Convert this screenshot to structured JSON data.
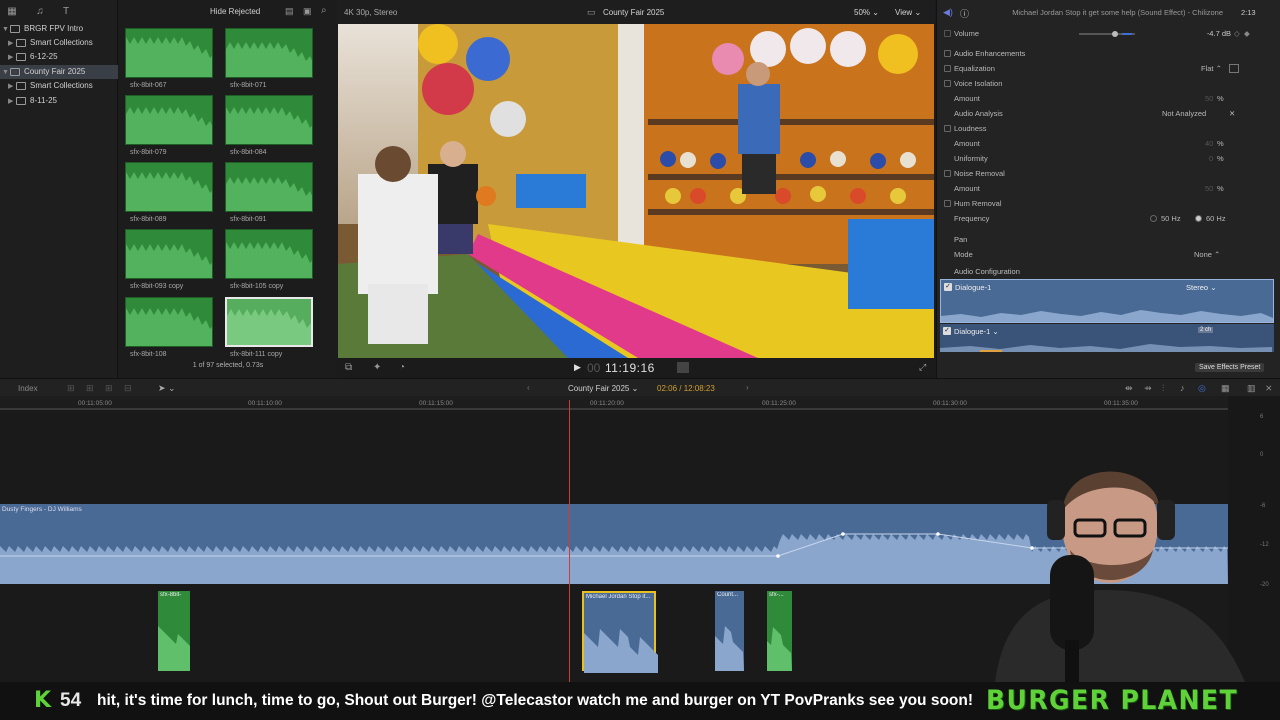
{
  "library": {
    "items": [
      {
        "label": "BRGR FPV Intro",
        "expanded": true,
        "selected": false
      },
      {
        "label": "Smart Collections",
        "expanded": false,
        "selected": false
      },
      {
        "label": "6-12-25",
        "expanded": false,
        "selected": false
      },
      {
        "label": "County Fair 2025",
        "expanded": true,
        "selected": true
      },
      {
        "label": "Smart Collections",
        "expanded": false,
        "selected": false
      },
      {
        "label": "8-11-25",
        "expanded": false,
        "selected": false
      }
    ]
  },
  "browser": {
    "filter_label": "Hide Rejected",
    "clips": [
      {
        "name": "sfx-8bit-067",
        "selected": false
      },
      {
        "name": "sfx-8bit-071",
        "selected": false
      },
      {
        "name": "sfx-8bit-079",
        "selected": false
      },
      {
        "name": "sfx-8bit-084",
        "selected": false
      },
      {
        "name": "sfx-8bit-089",
        "selected": false
      },
      {
        "name": "sfx-8bit-091",
        "selected": false
      },
      {
        "name": "sfx-8bit-093 copy",
        "selected": false
      },
      {
        "name": "sfx-8bit-105 copy",
        "selected": false
      },
      {
        "name": "sfx-8bit-108",
        "selected": false
      },
      {
        "name": "sfx-8bit-111 copy",
        "selected": true
      }
    ],
    "status": "1 of 97 selected, 0.73s"
  },
  "viewer": {
    "format": "4K 30p, Stereo",
    "project": "County Fair 2025",
    "zoom": "50%",
    "view_label": "View",
    "timecode_dim": "00",
    "timecode": "11:19:16"
  },
  "inspector": {
    "clip_title": "Michael Jordan Stop it get some help (Sound Effect) - Chilizone",
    "duration": "2:13",
    "volume_label": "Volume",
    "volume_value": "-4.7 dB",
    "audio_enhancements": "Audio Enhancements",
    "equalization": "Equalization",
    "equalization_value": "Flat",
    "voice_isolation": "Voice Isolation",
    "amount_label": "Amount",
    "vi_amount": "50",
    "audio_analysis": "Audio Analysis",
    "audio_analysis_value": "Not Analyzed",
    "loudness": "Loudness",
    "loudness_amount": "40",
    "uniformity": "Uniformity",
    "uniformity_value": "0",
    "noise_removal": "Noise Removal",
    "nr_amount": "50",
    "hum_removal": "Hum Removal",
    "frequency": "Frequency",
    "freq_50": "50 Hz",
    "freq_60": "60 Hz",
    "percent": "%",
    "pan": "Pan",
    "mode": "Mode",
    "mode_value": "None",
    "audio_config": "Audio Configuration",
    "channel1": "Dialogue-1",
    "channel1_format": "Stereo",
    "channel2": "Dialogue-1",
    "channel2_badge": "2 ch",
    "save_preset": "Save Effects Preset"
  },
  "timeline": {
    "index_label": "Index",
    "project_name": "County Fair 2025",
    "position": "02:06 / 12:08:23",
    "ruler_ticks": [
      "00:11:05:00",
      "00:11:10:00",
      "00:11:15:00",
      "00:11:20:00",
      "00:11:25:00",
      "00:11:30:00",
      "00:11:35:00"
    ],
    "music_track": "Dusty Fingers - DJ Williams",
    "clips": [
      {
        "label": "sfx-8bit-"
      },
      {
        "label": "Michael Jordan Stop it..."
      },
      {
        "label": "Count..."
      },
      {
        "label": "sfx-..."
      }
    ],
    "meter_labels": [
      "6",
      "0",
      "-6",
      "-12",
      "-20"
    ]
  },
  "ticker": {
    "badge": "K",
    "count": "54",
    "message": "hit, it's time for lunch, time to go, Shout out Burger! @Telecastor watch me and burger on YT PovPranks see you soon!",
    "brand": "BURGER PLANET"
  },
  "colors": {
    "accent": "#3d6fd6",
    "clip_green": "#2f8a3a",
    "audio_blue": "#4a6a96",
    "playhead": "#d23a3a",
    "brand_green": "#5fd23a"
  }
}
